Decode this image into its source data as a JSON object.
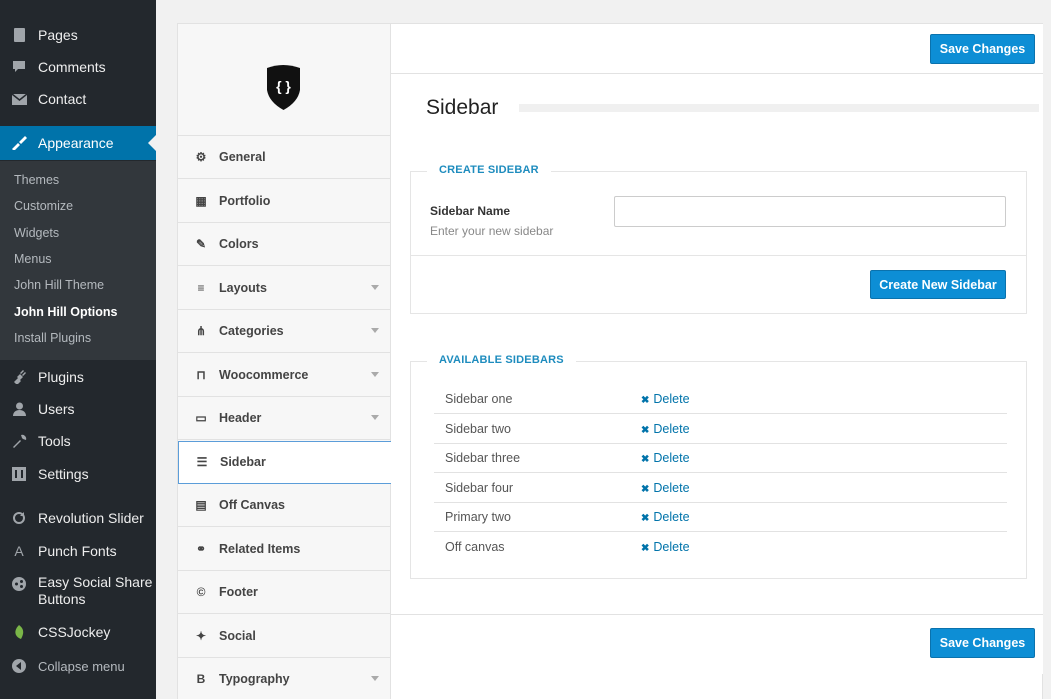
{
  "wp_menu": {
    "items_top": [
      {
        "label": "Pages",
        "icon": "pages-icon"
      },
      {
        "label": "Comments",
        "icon": "comments-icon"
      },
      {
        "label": "Contact",
        "icon": "contact-icon"
      }
    ],
    "active": {
      "label": "Appearance",
      "icon": "appearance-icon"
    },
    "submenu": [
      {
        "label": "Themes"
      },
      {
        "label": "Customize"
      },
      {
        "label": "Widgets"
      },
      {
        "label": "Menus"
      },
      {
        "label": "John Hill Theme"
      },
      {
        "label": "John Hill Options",
        "current": true
      },
      {
        "label": "Install Plugins"
      }
    ],
    "items_bottom": [
      {
        "label": "Plugins",
        "icon": "plugins-icon"
      },
      {
        "label": "Users",
        "icon": "users-icon"
      },
      {
        "label": "Tools",
        "icon": "tools-icon"
      },
      {
        "label": "Settings",
        "icon": "settings-icon"
      },
      {
        "label": "Revolution Slider",
        "icon": "revolution-slider-icon"
      },
      {
        "label": "Punch Fonts",
        "icon": "punch-fonts-icon"
      },
      {
        "label": "Easy Social Share",
        "label2": "Buttons",
        "icon": "easy-social-share-icon"
      },
      {
        "label": "CSSJockey",
        "icon": "cssjockey-icon"
      },
      {
        "label": "Collapse menu",
        "icon": "collapse-icon"
      }
    ]
  },
  "options_nav": [
    {
      "label": "General",
      "icon": "general-icon"
    },
    {
      "label": "Portfolio",
      "icon": "portfolio-icon"
    },
    {
      "label": "Colors",
      "icon": "colors-icon"
    },
    {
      "label": "Layouts",
      "icon": "layouts-icon",
      "caret": true
    },
    {
      "label": "Categories",
      "icon": "categories-icon",
      "caret": true
    },
    {
      "label": "Woocommerce",
      "icon": "woocommerce-icon",
      "caret": true
    },
    {
      "label": "Header",
      "icon": "header-icon",
      "caret": true
    },
    {
      "label": "Sidebar",
      "icon": "sidebar-icon",
      "active": true
    },
    {
      "label": "Off Canvas",
      "icon": "off-canvas-icon"
    },
    {
      "label": "Related Items",
      "icon": "related-items-icon"
    },
    {
      "label": "Footer",
      "icon": "footer-icon"
    },
    {
      "label": "Social",
      "icon": "social-icon"
    },
    {
      "label": "Typography",
      "icon": "typography-icon",
      "caret": true
    }
  ],
  "content": {
    "save_label": "Save Changes",
    "section_title": "Sidebar",
    "create": {
      "legend": "CREATE SIDEBAR",
      "field_label": "Sidebar Name",
      "field_desc": "Enter your new sidebar",
      "field_value": "",
      "button": "Create New Sidebar"
    },
    "available": {
      "legend": "AVAILABLE SIDEBARS",
      "delete_label": "Delete",
      "rows": [
        "Sidebar one",
        "Sidebar two",
        "Sidebar three",
        "Sidebar four",
        "Primary two",
        "Off canvas"
      ]
    }
  },
  "colors": {
    "wp_menu_bg": "#23282d",
    "wp_active": "#0073aa",
    "button_blue": "#0d8ed5",
    "legend_blue": "#1e8cbe"
  }
}
